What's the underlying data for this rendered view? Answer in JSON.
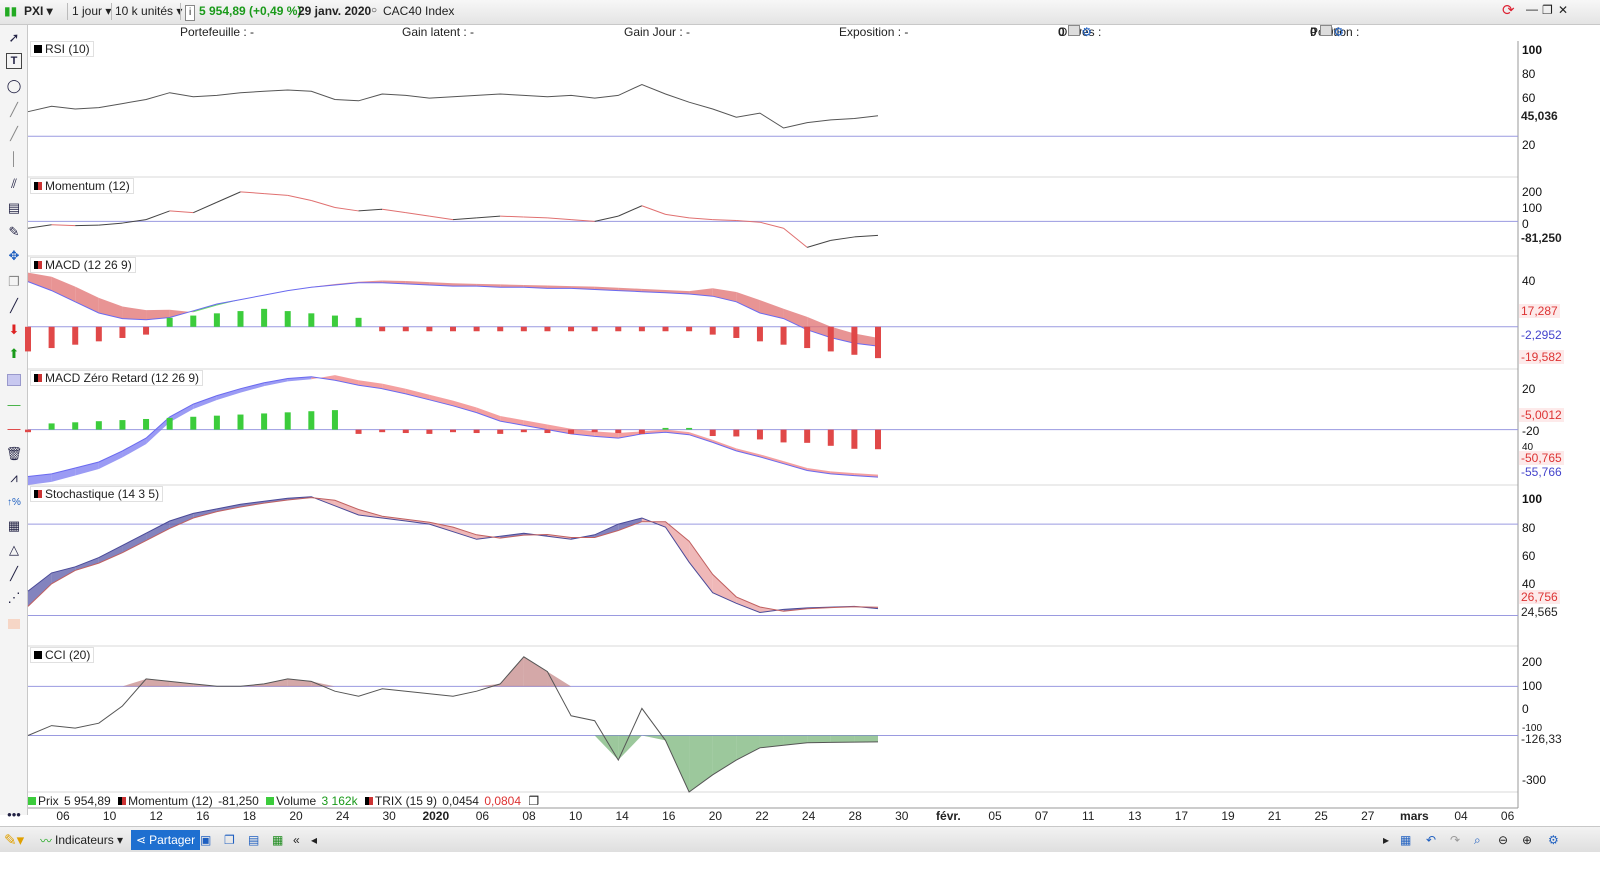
{
  "header": {
    "symbol": "PXI",
    "period": "1 jour",
    "units": "10 k unités",
    "price_change": "5 954,89 (+0,49 %)",
    "date": "29 janv. 2020",
    "index_name": "CAC40 Index"
  },
  "infobar": {
    "portefeuille": "Portefeuille : -",
    "gain_latent": "Gain latent : -",
    "gain_jour": "Gain Jour : -",
    "exposition": "Exposition : -",
    "ordres_label": "Ordres : ",
    "ordres_a": "0",
    "ordres_b": "/ 0",
    "position_label": "Position : ",
    "position_a": "0",
    "position_b": "/ 0"
  },
  "panels": {
    "rsi": {
      "title": "RSI (10)",
      "ticks": [
        "100",
        "80",
        "60",
        "20"
      ],
      "value": "45,036"
    },
    "momentum": {
      "title": "Momentum (12)",
      "ticks": [
        "200",
        "100",
        "0"
      ],
      "value": "-81,250"
    },
    "macd": {
      "title": "MACD (12 26 9)",
      "ticks": [
        "40"
      ],
      "v1": "17,287",
      "v2": "-2,2952",
      "v3": "-19,582"
    },
    "macdz": {
      "title": "MACD Zéro Retard (12 26 9)",
      "ticks": [
        "20",
        "-20",
        "40"
      ],
      "v1": "-5,0012",
      "v2": "-50,765",
      "v3": "-55,766"
    },
    "stoch": {
      "title": "Stochastique (14 3 5)",
      "ticks": [
        "100",
        "80",
        "60",
        "40"
      ],
      "v1": "26,756",
      "v2": "24,565"
    },
    "cci": {
      "title": "CCI (20)",
      "ticks": [
        "200",
        "100",
        "0",
        "-100",
        "-300"
      ],
      "value": "-126,33"
    }
  },
  "legend": {
    "prix_label": "Prix",
    "prix_value": "5 954,89",
    "mom_label": "Momentum (12)",
    "mom_value": "-81,250",
    "vol_label": "Volume",
    "vol_value": "3 162k",
    "trix_label": "TRIX (15 9)",
    "trix_v1": "0,0454",
    "trix_v2": "0,0804"
  },
  "xaxis_labels": [
    "06",
    "10",
    "12",
    "16",
    "18",
    "20",
    "24",
    "30",
    "2020",
    "06",
    "08",
    "10",
    "14",
    "16",
    "20",
    "22",
    "24",
    "28",
    "30",
    "févr.",
    "05",
    "07",
    "11",
    "13",
    "17",
    "19",
    "21",
    "25",
    "27",
    "mars",
    "04",
    "06"
  ],
  "bottom": {
    "indicateurs": "Indicateurs",
    "partager": "Partager"
  },
  "colors": {
    "up_green": "#3ccc3c",
    "down_red": "#e04848",
    "blue": "#6a6af0",
    "line": "#555555"
  },
  "chart_data": {
    "type": "line",
    "x": [
      "06",
      "09",
      "10",
      "11",
      "12",
      "13",
      "16",
      "17",
      "18",
      "19",
      "20",
      "23",
      "24",
      "27",
      "30",
      "31",
      "2020",
      "02",
      "03",
      "06",
      "07",
      "08",
      "09",
      "10",
      "13",
      "14",
      "15",
      "16",
      "17",
      "20",
      "21",
      "22",
      "23",
      "24",
      "27",
      "28",
      "29"
    ],
    "series": [
      {
        "name": "RSI (10)",
        "values": [
          48,
          52,
          50,
          51,
          54,
          57,
          62,
          59,
          60,
          62,
          63,
          64,
          63,
          57,
          56,
          61,
          60,
          58,
          59,
          60,
          61,
          60,
          59,
          60,
          58,
          60,
          68,
          61,
          55,
          50,
          44,
          47,
          36,
          40,
          42,
          43,
          45
        ]
      },
      {
        "name": "Momentum (12)",
        "values": [
          -40,
          -20,
          -25,
          -22,
          -10,
          10,
          60,
          50,
          110,
          170,
          160,
          150,
          120,
          80,
          60,
          70,
          50,
          30,
          10,
          20,
          30,
          25,
          20,
          10,
          0,
          30,
          90,
          40,
          20,
          10,
          5,
          -5,
          -40,
          -150,
          -110,
          -90,
          -81.25
        ]
      },
      {
        "name": "MACD (12 26 9)",
        "values": [
          38,
          30,
          20,
          10,
          5,
          4,
          6,
          12,
          18,
          22,
          26,
          30,
          33,
          35,
          37,
          37,
          36,
          35,
          34,
          34,
          33,
          33,
          32,
          32,
          31,
          30,
          29,
          28,
          27,
          25,
          20,
          10,
          5,
          -5,
          -12,
          -17,
          -19.582
        ]
      },
      {
        "name": "MACD Zéro Retard (12 26 9)",
        "values": [
          -55,
          -52,
          -45,
          -38,
          -25,
          -10,
          15,
          30,
          40,
          48,
          55,
          60,
          62,
          58,
          52,
          48,
          42,
          35,
          28,
          20,
          10,
          5,
          0,
          -5,
          -8,
          -10,
          -5,
          -3,
          -6,
          -15,
          -25,
          -32,
          -40,
          -48,
          -52,
          -54,
          -55.766
        ]
      },
      {
        "name": "Stochastique (14 3 5)",
        "values": [
          36,
          48,
          52,
          58,
          66,
          74,
          82,
          87,
          90,
          93,
          95,
          97,
          98,
          92,
          86,
          84,
          82,
          80,
          75,
          70,
          72,
          74,
          72,
          70,
          73,
          80,
          84,
          78,
          55,
          35,
          28,
          22,
          24,
          25,
          25.5,
          26,
          24.565
        ]
      },
      {
        "name": "CCI (20)",
        "values": [
          -100,
          -60,
          -70,
          -50,
          20,
          130,
          120,
          110,
          100,
          100,
          110,
          130,
          120,
          80,
          60,
          90,
          80,
          70,
          60,
          80,
          110,
          220,
          160,
          -20,
          -40,
          -200,
          10,
          -120,
          -330,
          -260,
          -200,
          -150,
          -140,
          -130,
          -128,
          -127,
          -126.33
        ]
      }
    ]
  }
}
